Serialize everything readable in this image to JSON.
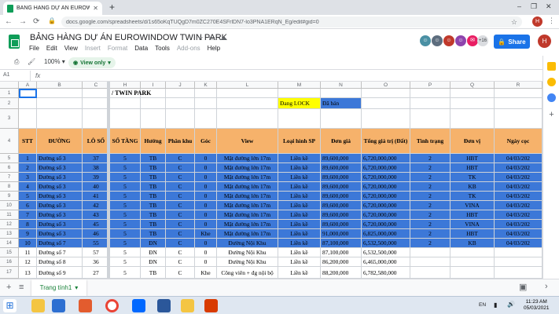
{
  "browser": {
    "tab_title": "BẢNG HÀNG DỰ ÁN EUROWINDO",
    "url": "docs.google.com/spreadsheets/d/1s65oKqTUQgD7m0ZC270E4SFrlDN7-lo3PNA1ERqN_Eg/edit#gid=0",
    "profile_initial": "H"
  },
  "app": {
    "doc_title": "BẢNG HÀNG DỰ ÁN EUROWINDOW TWIN PARK",
    "menu": [
      "File",
      "Edit",
      "View",
      "Insert",
      "Format",
      "Data",
      "Tools",
      "Add-ons",
      "Help"
    ],
    "menu_dim": [
      false,
      false,
      false,
      true,
      true,
      false,
      false,
      true,
      false
    ],
    "collab_more": "+16",
    "share_label": "Share",
    "avatar_initial": "H",
    "zoom": "100%",
    "view_only_label": "View only",
    "cell_ref": "A1",
    "fx": "fx"
  },
  "grid": {
    "col_headers": [
      "A",
      "B",
      "C",
      "H",
      "I",
      "J",
      "K",
      "L",
      "M",
      "N",
      "O",
      "P",
      "Q",
      "R"
    ],
    "row_headers": [
      "1",
      "2",
      "3",
      "4",
      "5",
      "6",
      "7",
      "8",
      "9",
      "10",
      "11",
      "12",
      "13",
      "14",
      "15",
      "16",
      "17"
    ],
    "r1_title": "/ TWIN PARK",
    "lock_label": "Đang LOCK",
    "sold_label": "Đã bán",
    "headers": [
      "STT",
      "ĐƯỜNG",
      "LÔ SỐ",
      "SỐ TẦNG",
      "Hướng",
      "Phân khu",
      "Góc",
      "View",
      "Loại hình SP",
      "Đơn giá",
      "Tổng giá trị (Đất)",
      "Tình trạng",
      "Đơn vị",
      "Ngày cọc"
    ],
    "rows": [
      [
        "1",
        "Đường số 3",
        "37",
        "5",
        "TB",
        "C",
        "0",
        "Mặt đường lớn 17m",
        "Liền kề",
        "89,600,000",
        "6,720,000,000",
        "2",
        "HBT",
        "04/03/202"
      ],
      [
        "2",
        "Đường số 3",
        "38",
        "5",
        "TB",
        "C",
        "0",
        "Mặt đường lớn 17m",
        "Liền kề",
        "89,600,000",
        "6,720,000,000",
        "2",
        "HBT",
        "04/03/202"
      ],
      [
        "3",
        "Đường số 3",
        "39",
        "5",
        "TB",
        "C",
        "0",
        "Mặt đường lớn 17m",
        "Liền kề",
        "89,600,000",
        "6,720,000,000",
        "2",
        "TK",
        "04/03/202"
      ],
      [
        "4",
        "Đường số 3",
        "40",
        "5",
        "TB",
        "C",
        "0",
        "Mặt đường lớn 17m",
        "Liền kề",
        "89,600,000",
        "6,720,000,000",
        "2",
        "KB",
        "04/03/202"
      ],
      [
        "5",
        "Đường số 3",
        "41",
        "5",
        "TB",
        "C",
        "0",
        "Mặt đường lớn 17m",
        "Liền kề",
        "89,600,000",
        "6,720,000,000",
        "2",
        "TK",
        "04/03/202"
      ],
      [
        "6",
        "Đường số 3",
        "42",
        "5",
        "TB",
        "C",
        "0",
        "Mặt đường lớn 17m",
        "Liền kề",
        "89,600,000",
        "6,720,000,000",
        "2",
        "VINA",
        "04/03/202"
      ],
      [
        "7",
        "Đường số 3",
        "43",
        "5",
        "TB",
        "C",
        "0",
        "Mặt đường lớn 17m",
        "Liền kề",
        "89,600,000",
        "6,720,000,000",
        "2",
        "HBT",
        "04/03/202"
      ],
      [
        "8",
        "Đường số 3",
        "45",
        "5",
        "TB",
        "C",
        "0",
        "Mặt đường lớn 17m",
        "Liền kề",
        "89,600,000",
        "6,720,000,000",
        "2",
        "VINA",
        "04/03/202"
      ],
      [
        "9",
        "Đường số 3",
        "46",
        "5",
        "TB",
        "C",
        "Khe",
        "Mặt đường lớn 17m",
        "Liền kề",
        "91,000,000",
        "6,825,000,000",
        "2",
        "HBT",
        "04/03/202"
      ],
      [
        "10",
        "Đường số 7",
        "55",
        "5",
        "ĐN",
        "C",
        "0",
        "Đường Nội Khu",
        "Liền kề",
        "87,100,000",
        "6,532,500,000",
        "2",
        "KB",
        "04/03/202"
      ],
      [
        "11",
        "Đường số 7",
        "57",
        "5",
        "ĐN",
        "C",
        "0",
        "Đường Nội Khu",
        "Liền kề",
        "87,100,000",
        "6,532,500,000",
        "",
        "",
        ""
      ],
      [
        "12",
        "Đường số 8",
        "36",
        "5",
        "ĐN",
        "C",
        "0",
        "Đường Nội Khu",
        "Liền kề",
        "86,200,000",
        "6,465,000,000",
        "",
        "",
        ""
      ],
      [
        "13",
        "Đường số 9",
        "27",
        "5",
        "TB",
        "C",
        "Khe",
        "Công viên + đg nội bộ",
        "Liền kề",
        "88,200,000",
        "6,782,580,000",
        "",
        "",
        ""
      ]
    ],
    "selected_rows": 10
  },
  "colors": {
    "header_fill": "#f6b26b",
    "selection_fill": "#3c78d8",
    "lock_fill": "#ffff00",
    "sold_fill": "#3c78d8"
  },
  "sheets": {
    "active": "Trang tính1"
  },
  "taskbar": {
    "lang": "EN",
    "time": "11:23 AM",
    "date": "05/03/2021"
  }
}
